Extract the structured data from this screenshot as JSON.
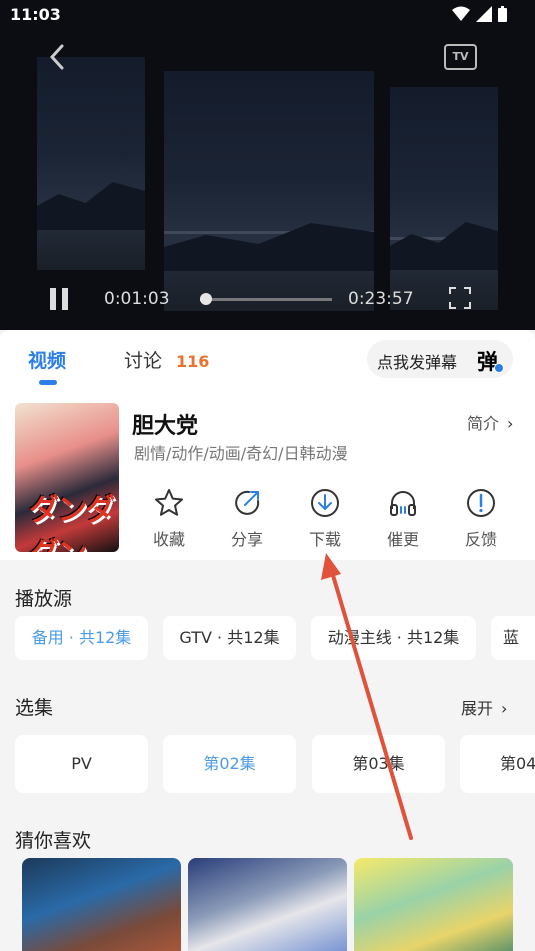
{
  "status_bar": {
    "time": "11:03"
  },
  "player": {
    "current_time": "0:01:03",
    "total_time": "0:23:57",
    "progress": 0.044,
    "back_icon": "chevron-left-icon",
    "cast_icon": "tv-cast-icon",
    "cast_label": "TV"
  },
  "tabs": {
    "video": "视频",
    "discussion": "讨论",
    "discussion_count": "116",
    "danmu_prompt": "点我发弹幕",
    "danmu_icon_text": "弹"
  },
  "anime": {
    "title": "胆大党",
    "genres": "剧情/动作/动画/奇幻/日韩动漫",
    "intro_label": "简介",
    "poster_logo": "ダンダダン"
  },
  "actions": [
    {
      "icon": "star-icon",
      "label": "收藏"
    },
    {
      "icon": "share-icon",
      "label": "分享"
    },
    {
      "icon": "download-icon",
      "label": "下载"
    },
    {
      "icon": "headphones-icon",
      "label": "催更"
    },
    {
      "icon": "feedback-icon",
      "label": "反馈"
    }
  ],
  "sources": {
    "title": "播放源",
    "items": [
      "备用 · 共12集",
      "GTV · 共12集",
      "动漫主线 · 共12集",
      "蓝"
    ],
    "selected_index": 0
  },
  "episodes": {
    "title": "选集",
    "expand_label": "展开",
    "items": [
      "PV",
      "第02集",
      "第03集",
      "第04"
    ],
    "selected_index": 1
  },
  "recommendations": {
    "title": "猜你喜欢"
  },
  "colors": {
    "accent": "#2b7fe6",
    "count": "#e6732e",
    "annotation_arrow": "#e0533a"
  }
}
